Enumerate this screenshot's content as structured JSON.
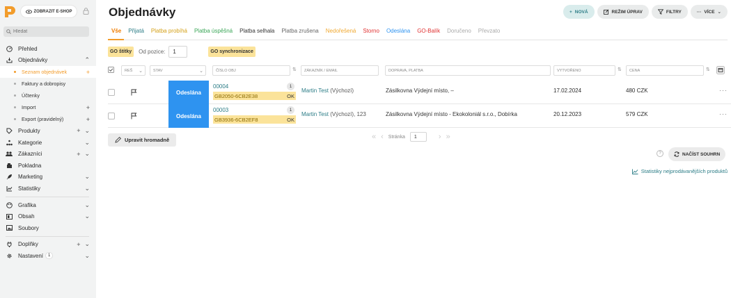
{
  "sidebar": {
    "eshop_button": "ZOBRAZIT E-SHOP",
    "search_placeholder": "Hledat",
    "items": [
      {
        "label": "Přehled"
      },
      {
        "label": "Objednávky"
      },
      {
        "label": "Seznam objednávek"
      },
      {
        "label": "Faktury a dobropisy"
      },
      {
        "label": "Účtenky"
      },
      {
        "label": "Import"
      },
      {
        "label": "Export (pravidelný)"
      },
      {
        "label": "Produkty"
      },
      {
        "label": "Kategorie"
      },
      {
        "label": "Zákazníci"
      },
      {
        "label": "Pokladna"
      },
      {
        "label": "Marketing"
      },
      {
        "label": "Statistiky"
      },
      {
        "label": "Grafika"
      },
      {
        "label": "Obsah"
      },
      {
        "label": "Soubory"
      },
      {
        "label": "Doplňky"
      },
      {
        "label": "Nastavení",
        "badge": "1"
      }
    ],
    "accent_color": "#f29c2b"
  },
  "header": {
    "title": "Objednávky",
    "buttons": {
      "new": "NOVÁ",
      "edit_mode": "REŽIM ÚPRAV",
      "filters": "FILTRY",
      "more": "VÍCE"
    }
  },
  "tabs": [
    {
      "label": "Vše",
      "color": "#f07d00"
    },
    {
      "label": "Přijatá",
      "color": "#2b7c86"
    },
    {
      "label": "Platba probíhá",
      "color": "#d4a017"
    },
    {
      "label": "Platba úspěšná",
      "color": "#3aa657"
    },
    {
      "label": "Platba selhala",
      "color": "#333333"
    },
    {
      "label": "Platba zrušena",
      "color": "#666666"
    },
    {
      "label": "Nedořešená",
      "color": "#f0a830"
    },
    {
      "label": "Storno",
      "color": "#e03030"
    },
    {
      "label": "Odeslána",
      "color": "#2e93f0"
    },
    {
      "label": "GO-Balík",
      "color": "#e03030"
    },
    {
      "label": "Doručeno",
      "color": "#aaaaaa"
    },
    {
      "label": "Převzato",
      "color": "#aaaaaa"
    }
  ],
  "filters": {
    "go_labels": "GO štítky",
    "from_position_label": "Od pozice:",
    "from_position_value": "1",
    "go_sync": "GO synchronizace"
  },
  "columns": {
    "res": "REŠ",
    "status": "STAV",
    "order_number": "ČÍSLO OBJ",
    "customer": "ZÁKAZNÍK / EMAIL",
    "shipping": "DOPRAVA, PLATBA",
    "created": "VYTVOŘENO",
    "price": "CENA"
  },
  "orders": [
    {
      "status": "Odeslána",
      "number": "00004",
      "count": "1",
      "go_code": "GB2050-6CB2E38",
      "go_state": "OK",
      "customer_name": "Martin Test",
      "customer_extra": "(Výchozí)",
      "shipping": "Zásilkovna Výdejní místo, –",
      "created": "17.02.2024",
      "price": "480 CZK"
    },
    {
      "status": "Odeslána",
      "number": "00003",
      "count": "1",
      "go_code": "GB3936-6CB2EF8",
      "go_state": "OK",
      "customer_name": "Martin Test",
      "customer_extra": "(Výchozí), 123",
      "shipping": "Zásilkovna Výdejní místo - Ekokoloniál s.r.o., Dobírka",
      "created": "20.12.2023",
      "price": "579 CZK"
    }
  ],
  "footer": {
    "bulk_edit": "Upravit hromadně",
    "page_label": "Stránka",
    "page_value": "1",
    "load_summary": "NAČÍST SOUHRN",
    "stats_link": "Statistiky nejprodávanějších produktů"
  }
}
